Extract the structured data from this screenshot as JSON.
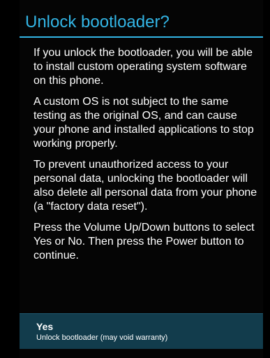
{
  "dialog": {
    "title": "Unlock bootloader?",
    "paragraphs": [
      "If you unlock the bootloader, you will be able to install custom operating system software on this phone.",
      "A custom OS is not subject to the same testing as the original OS, and can cause your phone and installed applications to stop working properly.",
      "To prevent unauthorized access to your personal data, unlocking the bootloader will also delete all personal data from your phone (a \"factory data reset\").",
      "Press the Volume Up/Down buttons to select Yes or No. Then press the Power button to continue."
    ],
    "options": [
      {
        "label": "Yes",
        "description": "Unlock bootloader (may void warranty)",
        "selected": true
      }
    ]
  },
  "colors": {
    "background": "#050505",
    "accent": "#33b5e5",
    "selected_option": "#123c4c",
    "text": "#ffffff"
  }
}
